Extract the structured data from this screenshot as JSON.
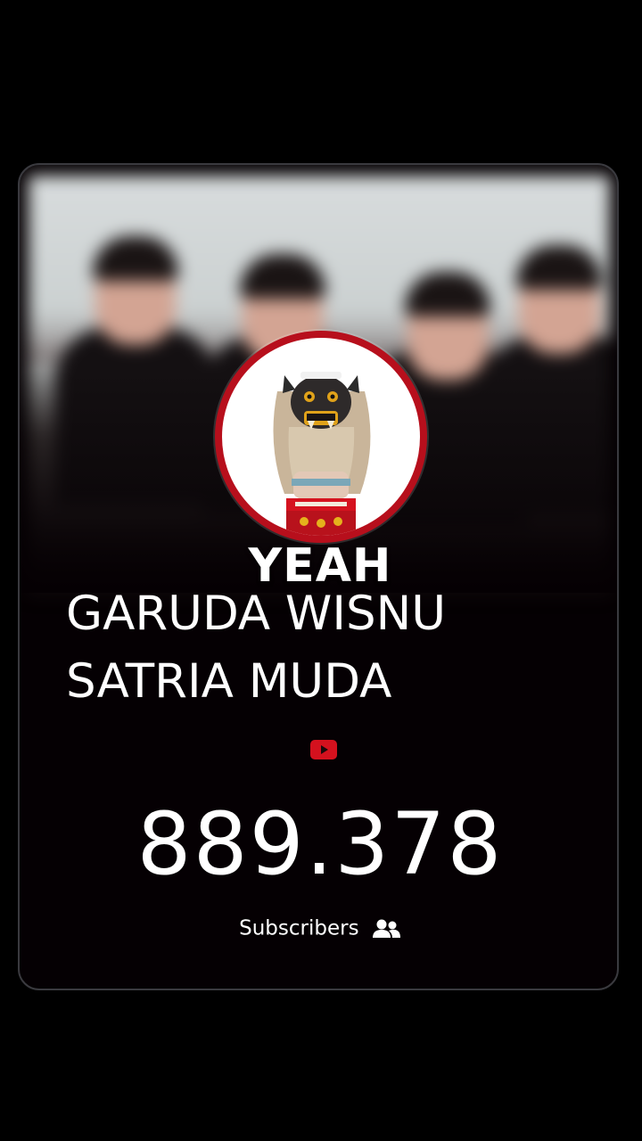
{
  "overlay": {
    "title_text": "YEAH"
  },
  "channel": {
    "name_line1": "GARUDA WISNU",
    "name_line2": "SATRIA MUDA",
    "platform_icon": "youtube-icon",
    "subscriber_count": "889.378",
    "subscriber_label": "Subscribers",
    "subscriber_icon": "users-icon"
  },
  "colors": {
    "background": "#000000",
    "card_border": "#3a3a3f",
    "avatar_ring": "#b70f1c",
    "youtube_red": "#d4111e",
    "text": "#ffffff"
  }
}
